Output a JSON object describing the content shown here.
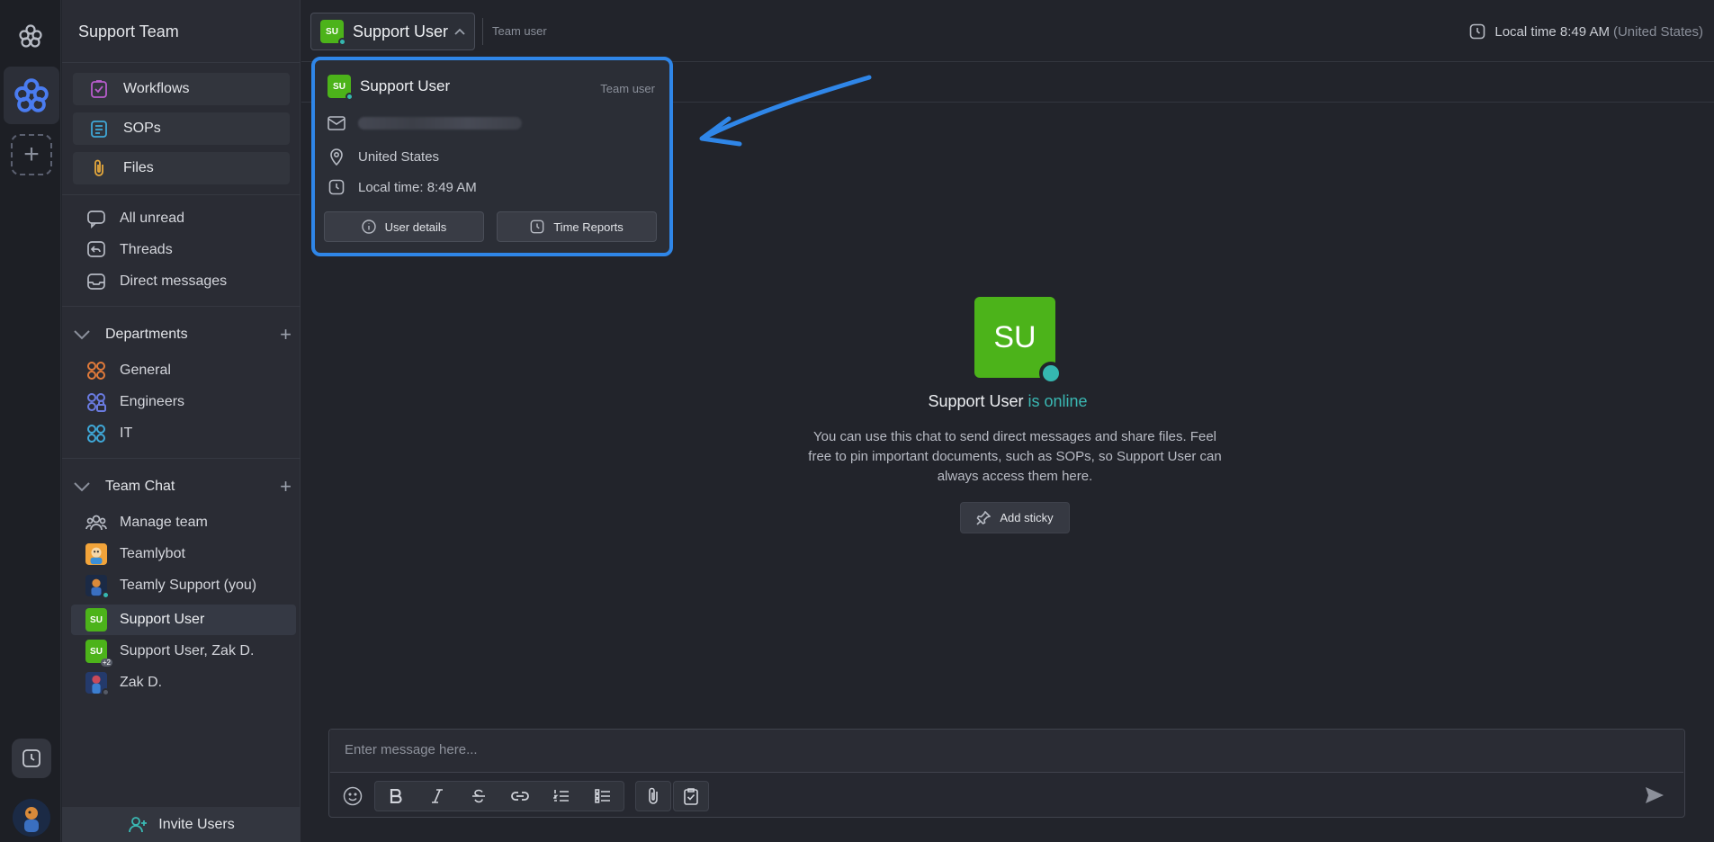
{
  "workspace": {
    "name": "Support Team"
  },
  "sidebar": {
    "pinned": [
      {
        "label": "Workflows",
        "icon": "workflow-icon",
        "color": "#b85ccc"
      },
      {
        "label": "SOPs",
        "icon": "sop-list-icon",
        "color": "#3fa8d8"
      },
      {
        "label": "Files",
        "icon": "paperclip-icon",
        "color": "#e6a93c"
      }
    ],
    "nav": [
      {
        "label": "All unread",
        "icon": "chat-bubble-icon"
      },
      {
        "label": "Threads",
        "icon": "thread-icon"
      },
      {
        "label": "Direct messages",
        "icon": "inbox-icon"
      }
    ],
    "departments": {
      "title": "Departments",
      "items": [
        {
          "label": "General",
          "color": "#e07a3a"
        },
        {
          "label": "Engineers",
          "color": "#6a7be0"
        },
        {
          "label": "IT",
          "color": "#3fa8d8"
        }
      ]
    },
    "team_chat": {
      "title": "Team Chat",
      "items": [
        {
          "label": "Manage team"
        },
        {
          "label": "Teamlybot"
        },
        {
          "label": "Teamly Support (you)"
        },
        {
          "label": "Support User",
          "initials": "SU"
        },
        {
          "label": "Support User, Zak D.",
          "initials": "SU",
          "badge": "+2"
        },
        {
          "label": "Zak D."
        }
      ]
    },
    "invite_label": "Invite Users"
  },
  "header": {
    "user_initials": "SU",
    "user_name": "Support User",
    "role": "Team user",
    "local_time": "Local time 8:49 AM",
    "country": "(United States)"
  },
  "popup": {
    "initials": "SU",
    "name": "Support User",
    "role": "Team user",
    "location": "United States",
    "local_time": "Local time: 8:49 AM",
    "user_details_label": "User details",
    "time_reports_label": "Time Reports"
  },
  "main": {
    "avatar_initials": "SU",
    "user_name": "Support User",
    "status_text": "is online",
    "description": "You can use this chat to send direct messages and share files. Feel free to pin important documents, such as SOPs, so Support User can always access them here.",
    "add_sticky_label": "Add sticky"
  },
  "composer": {
    "placeholder": "Enter message here..."
  },
  "colors": {
    "accent_green": "#4cb31a",
    "online_teal": "#3ab8b3",
    "highlight_blue": "#2f86e8"
  }
}
